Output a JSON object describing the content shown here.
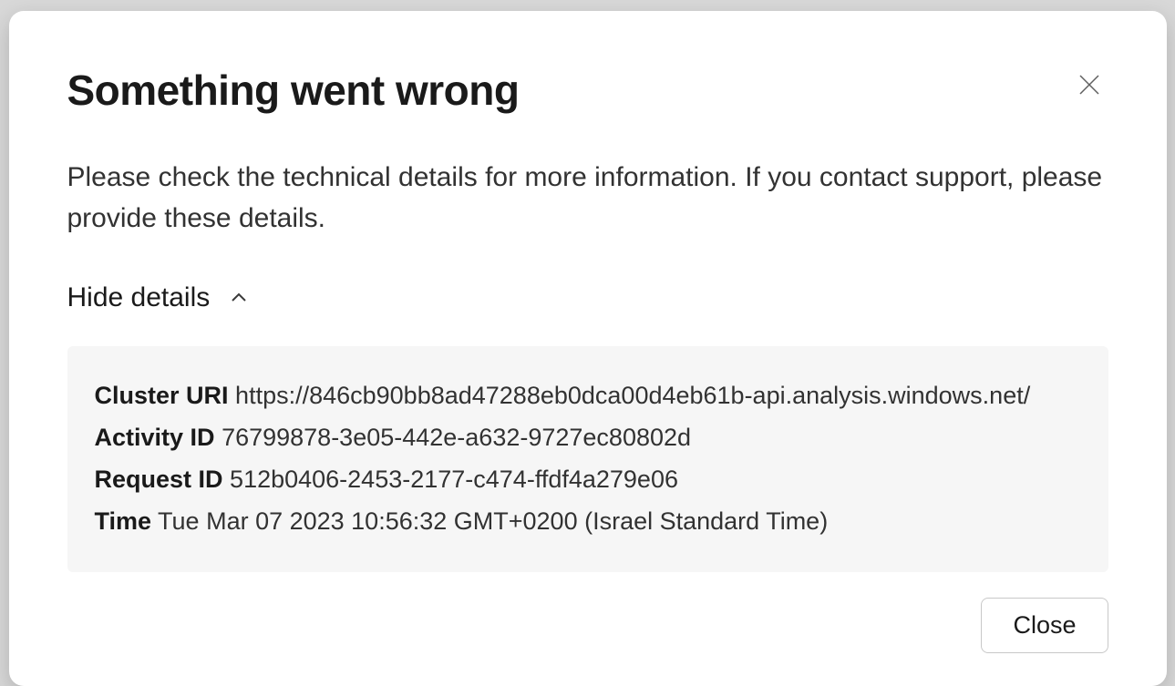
{
  "dialog": {
    "title": "Something went wrong",
    "message": "Please check the technical details for more information. If you contact support, please provide these details.",
    "toggle_label": "Hide details",
    "details": {
      "cluster_uri": {
        "label": "Cluster URI",
        "value": "https://846cb90bb8ad47288eb0dca00d4eb61b-api.analysis.windows.net/"
      },
      "activity_id": {
        "label": "Activity ID",
        "value": "76799878-3e05-442e-a632-9727ec80802d"
      },
      "request_id": {
        "label": "Request ID",
        "value": "512b0406-2453-2177-c474-ffdf4a279e06"
      },
      "time": {
        "label": "Time",
        "value": "Tue Mar 07 2023 10:56:32 GMT+0200 (Israel Standard Time)"
      }
    },
    "close_button_label": "Close"
  }
}
